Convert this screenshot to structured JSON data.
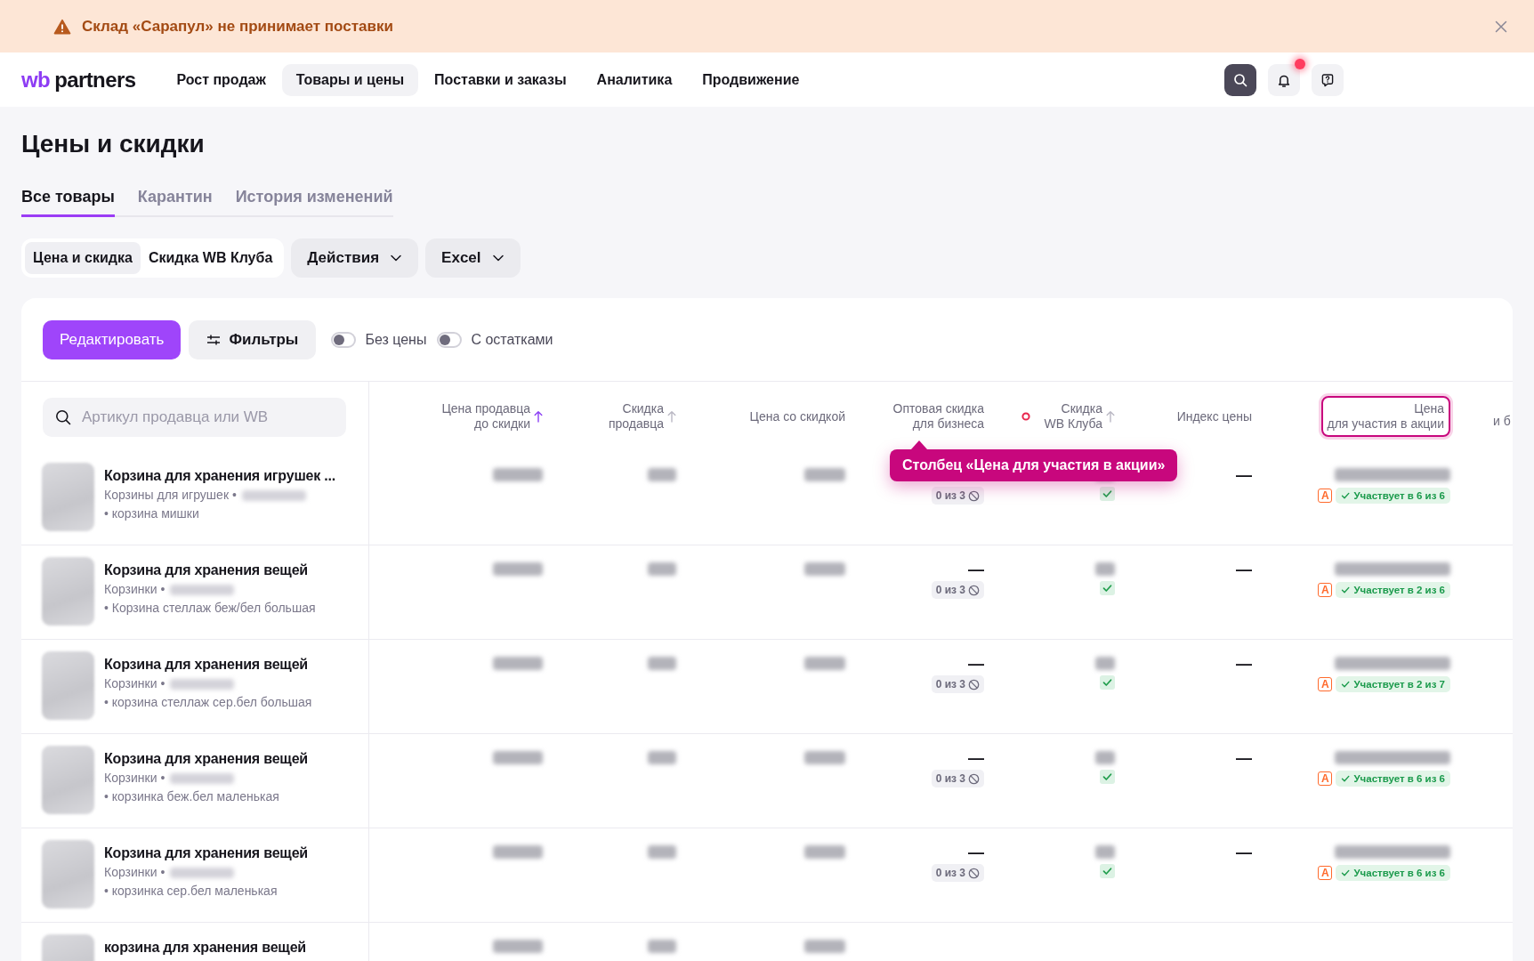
{
  "banner": {
    "text": "Склад «Сарапул» не принимает поставки"
  },
  "header": {
    "logo": {
      "mark": "wb",
      "name": "partners"
    },
    "nav": [
      {
        "label": "Рост продаж",
        "selected": false
      },
      {
        "label": "Товары и цены",
        "selected": true
      },
      {
        "label": "Поставки и заказы",
        "selected": false
      },
      {
        "label": "Аналитика",
        "selected": false
      },
      {
        "label": "Продвижение",
        "selected": false
      }
    ],
    "notification": true
  },
  "page": {
    "title": "Цены и скидки",
    "tabs": [
      {
        "label": "Все товары",
        "selected": true
      },
      {
        "label": "Карантин",
        "selected": false
      },
      {
        "label": "История изменений",
        "selected": false
      }
    ],
    "view_switch": [
      {
        "label": "Цена и скидка",
        "selected": true
      },
      {
        "label": "Скидка WB Клуба",
        "selected": false
      }
    ],
    "menus": [
      {
        "label": "Действия"
      },
      {
        "label": "Excel"
      }
    ]
  },
  "toolbar": {
    "edit_button": "Редактировать",
    "filter_button": "Фильтры",
    "toggles": [
      {
        "label": "Без цены",
        "on": false
      },
      {
        "label": "С остатками",
        "on": false
      }
    ]
  },
  "table": {
    "search": {
      "placeholder": "Артикул продавца или WB"
    },
    "columns": [
      {
        "kind": "price",
        "label": "Цена продавца\nдо скидки",
        "sort_active": true,
        "highlighted": false
      },
      {
        "kind": "percent",
        "label": "Скидка\nпродавца",
        "sort_active": false,
        "highlighted": false
      },
      {
        "kind": "price",
        "label": "Цена со скидкой",
        "highlighted": false
      },
      {
        "kind": "wholesale",
        "label": "Оптовая скидка\nдля бизнеса",
        "highlighted": false
      },
      {
        "kind": "club",
        "label": "Скидка\nWB Клуба",
        "sort_active": false,
        "highlighted": false
      },
      {
        "kind": "index",
        "label": "Индекс цены",
        "highlighted": false
      },
      {
        "kind": "promo",
        "label": "Цена\nдля участия в акции",
        "highlighted": true
      },
      {
        "kind": "cut",
        "label": "и б",
        "highlighted": false
      }
    ],
    "rows": [
      {
        "title": "Корзина для хранения игрушек ...",
        "category": "Корзины для игрушек •",
        "variant": "• корзина мишки",
        "wholesale": {
          "chip": "0 из 3"
        },
        "club_checked": true,
        "index": "—",
        "promo": {
          "tag": "A",
          "badge": "Участвует в 6 из 6"
        }
      },
      {
        "title": "Корзина для хранения вещей",
        "category": "Корзинки •",
        "variant": "• Корзина стеллаж беж/бел большая",
        "wholesale": {
          "value": "—",
          "chip": "0 из 3"
        },
        "club_checked": true,
        "index": "—",
        "promo": {
          "tag": "A",
          "badge": "Участвует в 2 из 6"
        }
      },
      {
        "title": "Корзина для хранения вещей",
        "category": "Корзинки •",
        "variant": "• корзина стеллаж сер.бел большая",
        "wholesale": {
          "value": "—",
          "chip": "0 из 3"
        },
        "club_checked": true,
        "index": "—",
        "promo": {
          "tag": "A",
          "badge": "Участвует в 2 из 7"
        }
      },
      {
        "title": "Корзина для хранения вещей",
        "category": "Корзинки •",
        "variant": "• корзинка беж.бел маленькая",
        "wholesale": {
          "value": "—",
          "chip": "0 из 3"
        },
        "club_checked": true,
        "index": "—",
        "promo": {
          "tag": "A",
          "badge": "Участвует в 6 из 6"
        }
      },
      {
        "title": "Корзина для хранения вещей",
        "category": "Корзинки •",
        "variant": "• корзинка сер.бел маленькая",
        "wholesale": {
          "value": "—",
          "chip": "0 из 3"
        },
        "club_checked": true,
        "index": "—",
        "promo": {
          "tag": "A",
          "badge": "Участвует в 6 из 6"
        }
      },
      {
        "title": "корзина для хранения вещей"
      }
    ],
    "tooltip": {
      "text": "Столбец «Цена для участия в акции»"
    }
  }
}
